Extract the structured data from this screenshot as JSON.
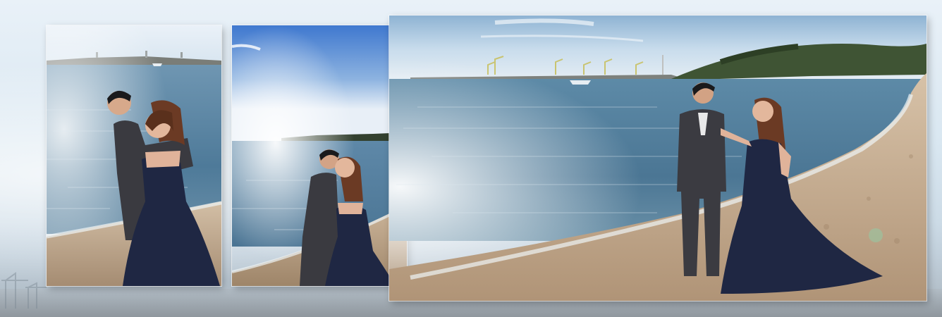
{
  "layout": "three-photo-collage",
  "colors": {
    "background": "#dfe9f2",
    "sky_top": "#4f86d6",
    "sea": "#4d7897",
    "sand": "#c9b093",
    "dress": "#1f2743",
    "suit": "#3a3a40"
  },
  "photos": [
    {
      "name": "couple-embrace-beach"
    },
    {
      "name": "couple-kiss-shoreline"
    },
    {
      "name": "couple-facing-waterfront"
    }
  ]
}
